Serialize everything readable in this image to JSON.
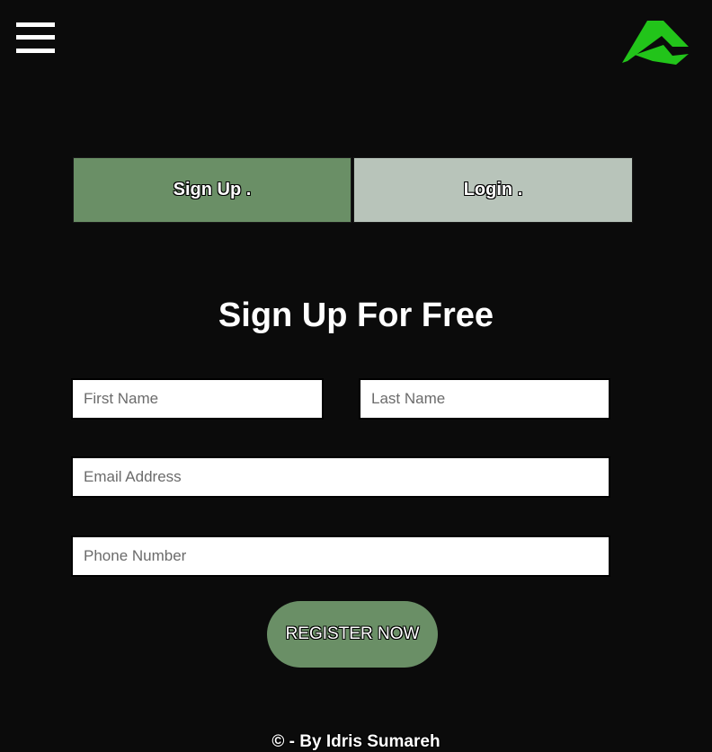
{
  "header": {
    "menu_icon": "hamburger-menu-icon",
    "logo_icon": "green-logo-icon",
    "logo_color": "#22c41a"
  },
  "tabs": [
    {
      "label": "Sign Up .",
      "active": true
    },
    {
      "label": "Login .",
      "active": false
    }
  ],
  "form": {
    "title": "Sign Up For Free",
    "first_name_placeholder": "First Name",
    "last_name_placeholder": "Last Name",
    "email_placeholder": "Email Address",
    "phone_placeholder": "Phone Number",
    "submit_label": "REGISTER NOW"
  },
  "footer": {
    "text": "© - By Idris Sumareh"
  },
  "colors": {
    "background": "#0b0b0b",
    "accent": "#6a8f66",
    "tab_inactive": "#b8c4ba"
  }
}
